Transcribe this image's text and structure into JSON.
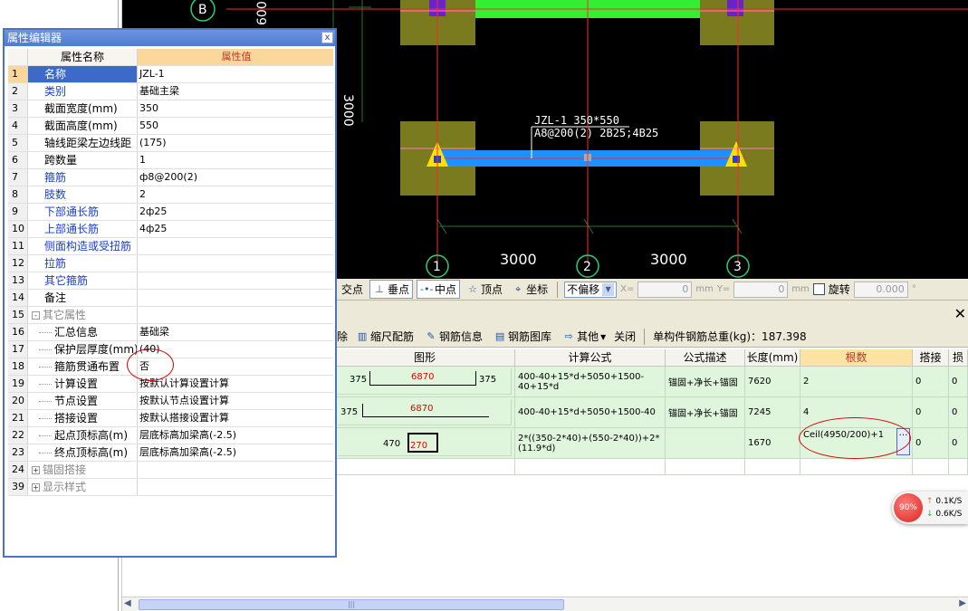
{
  "cad": {
    "axis_b": "B",
    "axis_1": "1",
    "axis_2": "2",
    "axis_3": "3",
    "dim_left": "3000",
    "dim_right": "3000",
    "dim_vert_top": "600",
    "dim_vert_mid": "3000",
    "beam_label_1": "JZL-1 350*550",
    "beam_label_2": "A8@200(2) 2B25;4B25"
  },
  "snapbar": {
    "intersection": "交点",
    "perpendicular": "垂点",
    "midpoint": "中点",
    "vertex": "顶点",
    "coordinate": "坐标",
    "offset_mode": "不偏移",
    "x_label": "X=",
    "x_value": "0",
    "unit_mm": "mm",
    "y_label": "Y=",
    "y_value": "0",
    "rotate": "旋转",
    "rotate_value": "0.000",
    "degree": "°"
  },
  "rebar_panel": {
    "toolbar": {
      "delete": "除",
      "scale_rebar": "缩尺配筋",
      "rebar_info": "钢筋信息",
      "rebar_library": "钢筋图库",
      "other": "其他",
      "close": "关闭",
      "total_weight_label": "单构件钢筋总重(kg)：187.398"
    },
    "columns": [
      "图形",
      "计算公式",
      "公式描述",
      "长度(mm)",
      "根数",
      "搭接",
      "损耗"
    ],
    "rows": [
      {
        "shape_left": "375",
        "shape_mid": "6870",
        "shape_right": "375",
        "formula": "400-40+15*d+5050+1500-40+15*d",
        "desc": "锚固+净长+锚固",
        "length": "7620",
        "count": "2",
        "lap": "0",
        "loss": "0"
      },
      {
        "shape_left": "375",
        "shape_mid": "6870",
        "shape_right": "",
        "formula": "400-40+15*d+5050+1500-40",
        "desc": "锚固+净长+锚固",
        "length": "7245",
        "count": "4",
        "lap": "0",
        "loss": "0"
      },
      {
        "shape_left": "470",
        "shape_mid": "270",
        "shape_right": "",
        "formula": "2*((350-2*40)+(550-2*40))+2*(11.9*d)",
        "desc": "",
        "length": "1670",
        "count": "Ceil(4950/200)+1",
        "lap": "0",
        "loss": "0"
      }
    ],
    "more_button": "…"
  },
  "speed": {
    "percent": "90%",
    "up": "0.1K/S",
    "down": "0.6K/S"
  },
  "property_editor": {
    "title": "属性编辑器",
    "close": "x",
    "col_name": "属性名称",
    "col_value": "属性值",
    "rows": [
      {
        "n": "1",
        "k": "名称",
        "v": "JZL-1"
      },
      {
        "n": "2",
        "k": "类别",
        "v": "基础主梁"
      },
      {
        "n": "3",
        "k": "截面宽度(mm)",
        "v": "350"
      },
      {
        "n": "4",
        "k": "截面高度(mm)",
        "v": "550"
      },
      {
        "n": "5",
        "k": "轴线距梁左边线距",
        "v": "(175)"
      },
      {
        "n": "6",
        "k": "跨数量",
        "v": "1"
      },
      {
        "n": "7",
        "k": "箍筋",
        "v": "ф8@200(2)"
      },
      {
        "n": "8",
        "k": "肢数",
        "v": "2"
      },
      {
        "n": "9",
        "k": "下部通长筋",
        "v": "2ф25"
      },
      {
        "n": "10",
        "k": "上部通长筋",
        "v": "4ф25"
      },
      {
        "n": "11",
        "k": "侧面构造或受扭筋",
        "v": ""
      },
      {
        "n": "12",
        "k": "拉筋",
        "v": ""
      },
      {
        "n": "13",
        "k": "其它箍筋",
        "v": ""
      },
      {
        "n": "14",
        "k": "备注",
        "v": ""
      },
      {
        "n": "15",
        "k": "其它属性",
        "v": ""
      },
      {
        "n": "16",
        "k": "汇总信息",
        "v": "基础梁"
      },
      {
        "n": "17",
        "k": "保护层厚度(mm)",
        "v": "(40)"
      },
      {
        "n": "18",
        "k": "箍筋贯通布置",
        "v": "否"
      },
      {
        "n": "19",
        "k": "计算设置",
        "v": "按默认计算设置计算"
      },
      {
        "n": "20",
        "k": "节点设置",
        "v": "按默认节点设置计算"
      },
      {
        "n": "21",
        "k": "搭接设置",
        "v": "按默认搭接设置计算"
      },
      {
        "n": "22",
        "k": "起点顶标高(m)",
        "v": "层底标高加梁高(-2.5)"
      },
      {
        "n": "23",
        "k": "终点顶标高(m)",
        "v": "层底标高加梁高(-2.5)"
      },
      {
        "n": "24",
        "k": "锚固搭接",
        "v": ""
      },
      {
        "n": "39",
        "k": "显示样式",
        "v": ""
      }
    ]
  },
  "colors": {
    "canvas": "#000000",
    "column_fill": "#7a7a1e",
    "beam_blue": "#1e90ff",
    "beam_green": "#33ee33",
    "grid_red": "#ff2a2a",
    "grid_green": "#2ecc71",
    "selection_blue": "#3d69c8",
    "header_orange": "#fbd79b"
  }
}
